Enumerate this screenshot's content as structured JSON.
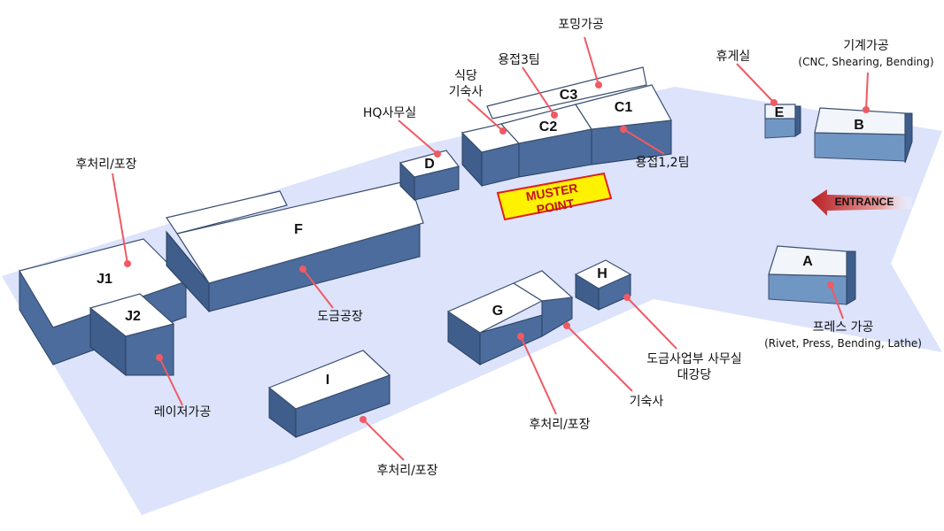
{
  "colors": {
    "ground": "#dce3fb",
    "building_top": "#ffffff",
    "building_side": "#3f5e8c",
    "leader": "#ef5a64",
    "muster_fill": "#fff200",
    "muster_border": "#e02020",
    "entrance_arrow": "#c8282d"
  },
  "blocks": {
    "J1": "J1",
    "J2": "J2",
    "F": "F",
    "D": "D",
    "C3": "C3",
    "C2": "C2",
    "C1": "C1",
    "E": "E",
    "B": "B",
    "A": "A",
    "G": "G",
    "H": "H",
    "I": "I"
  },
  "labels": {
    "forming": "포밍가공",
    "welding3": "용접3팀",
    "cafeteria_line1": "식당",
    "cafeteria_line2": "기숙사",
    "hq_office": "HQ사무실",
    "post_packaging_left": "후처리/포장",
    "welding12": "용접1,2팀",
    "lounge": "휴게실",
    "machining": "기계가공",
    "machining_sub": "(CNC, Shearing, Bending)",
    "plating_plant": "도금공장",
    "laser": "레이저가공",
    "press_line1": "프레스 가공",
    "press_line2": "(Rivet, Press,  Bending, Lathe)",
    "plating_office_line1": "도금사업부 사무실",
    "plating_office_line2": "대강당",
    "dorm": "기숙사",
    "post_packaging_g": "후처리/포장",
    "post_packaging_bottom": "후처리/포장"
  },
  "muster": {
    "line1": "MUSTER",
    "line2": "POINT"
  },
  "entrance": "ENTRANCE"
}
